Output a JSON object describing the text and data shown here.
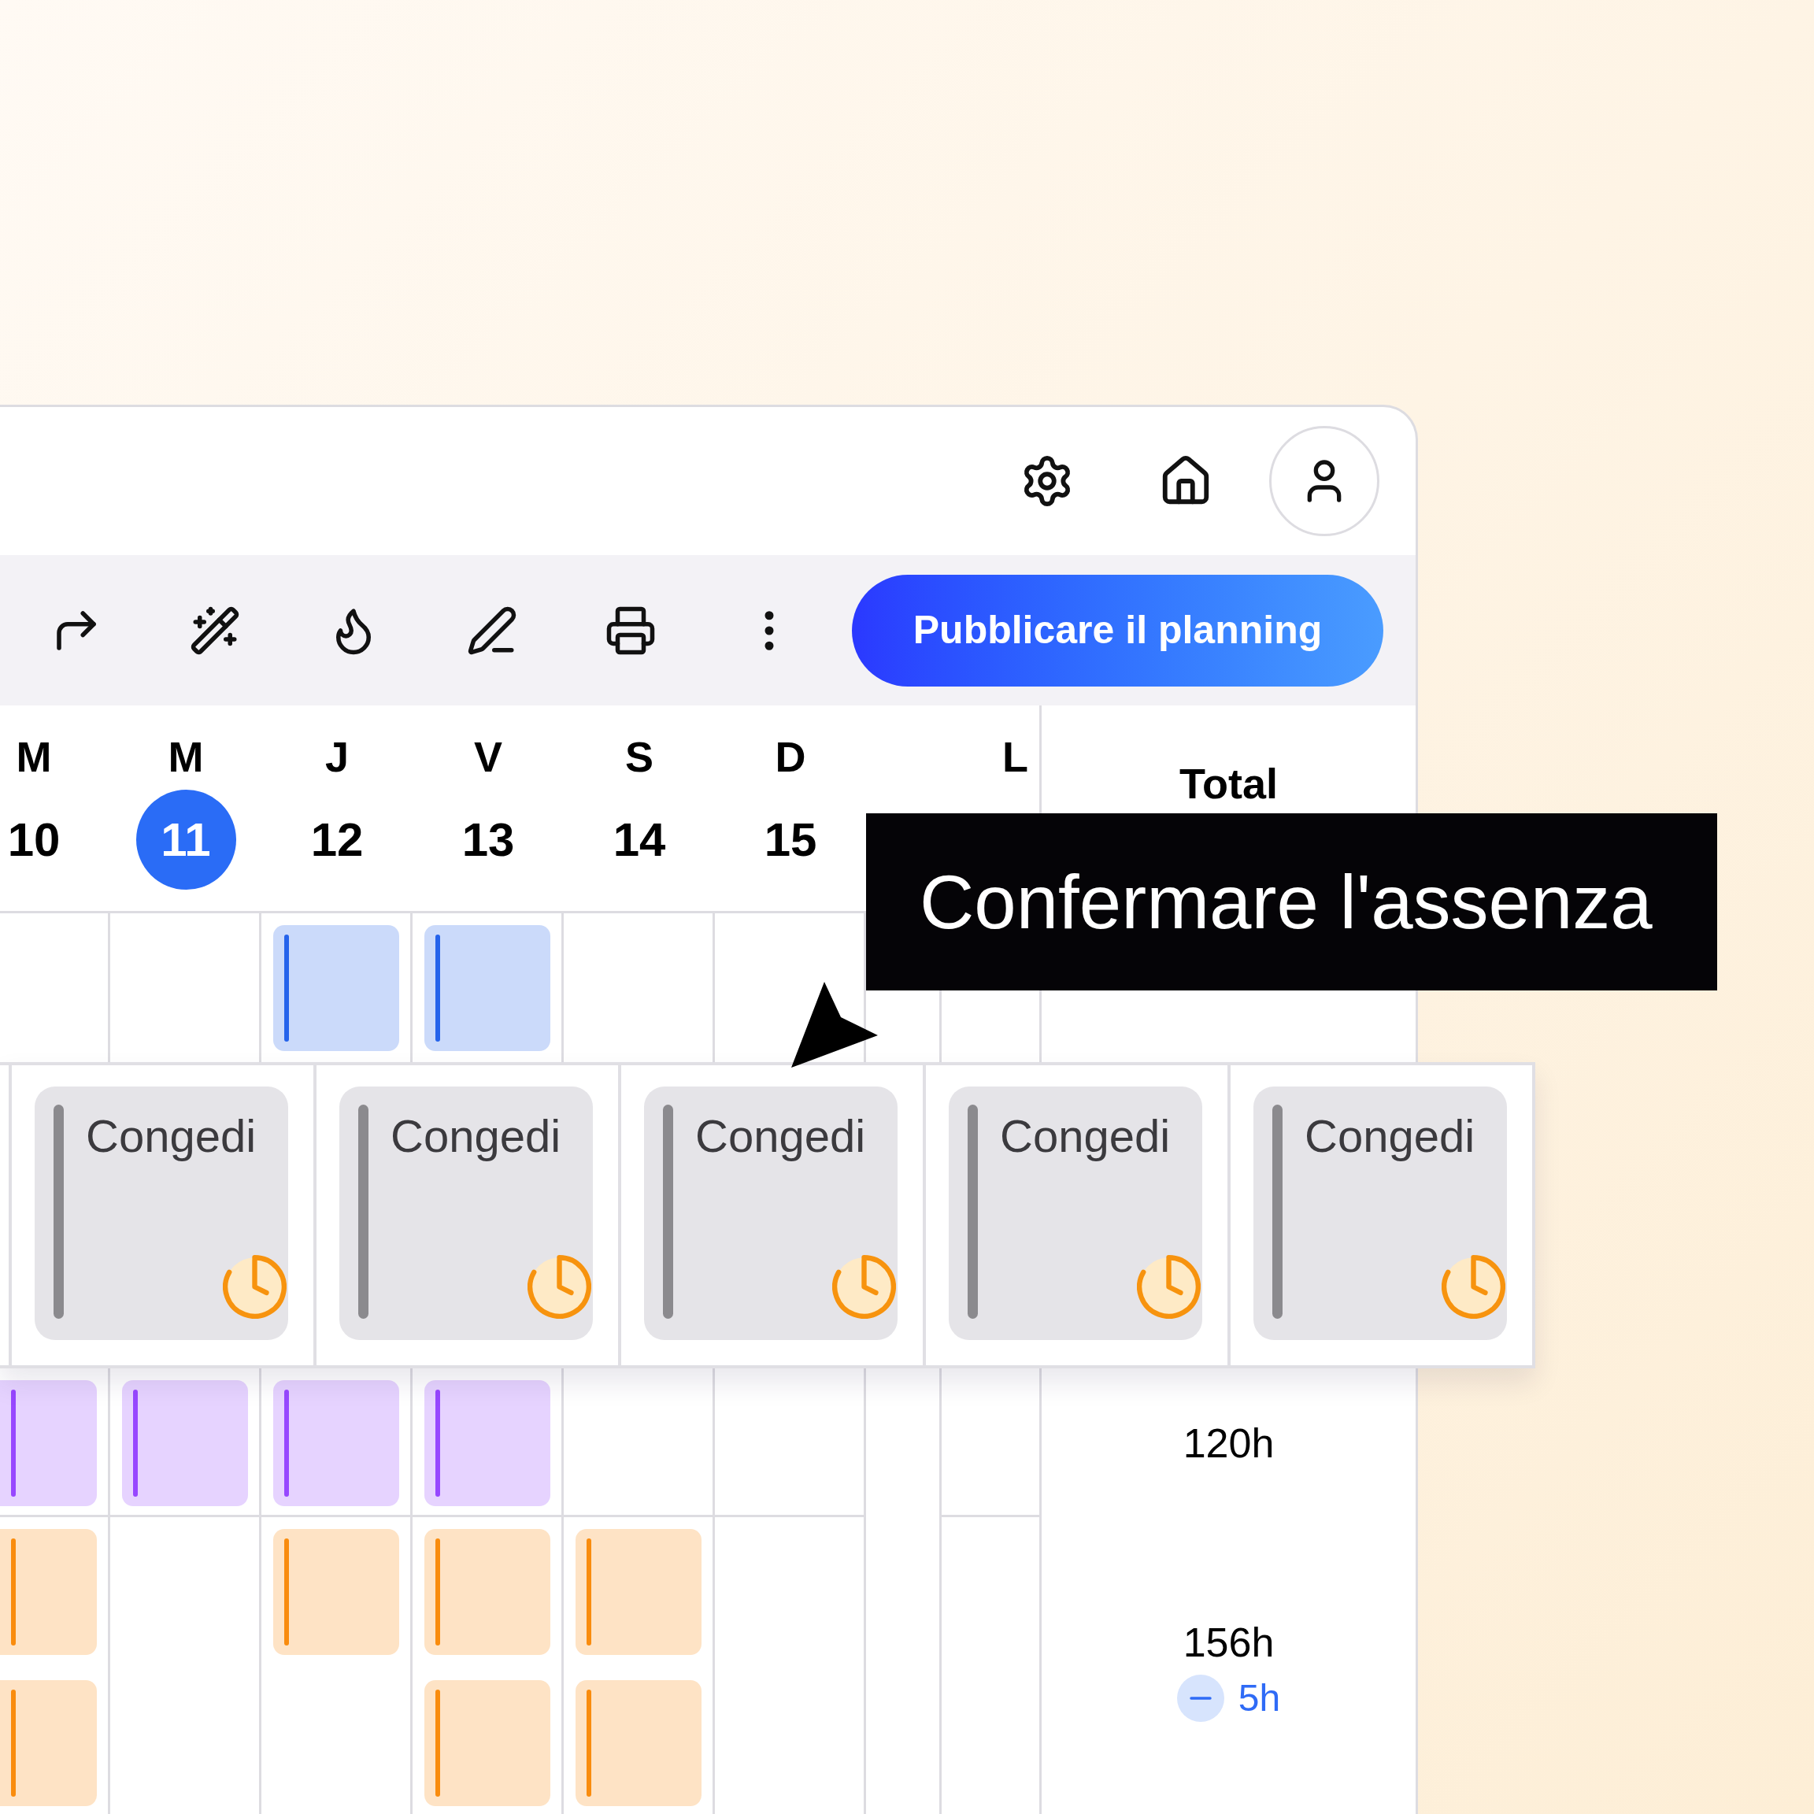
{
  "toolbar": {
    "publish_button": "Pubblicare il planning"
  },
  "days": [
    {
      "weekday": "M",
      "date": "10",
      "selected": false
    },
    {
      "weekday": "M",
      "date": "11",
      "selected": true
    },
    {
      "weekday": "J",
      "date": "12",
      "selected": false
    },
    {
      "weekday": "V",
      "date": "13",
      "selected": false
    },
    {
      "weekday": "S",
      "date": "14",
      "selected": false
    },
    {
      "weekday": "D",
      "date": "15",
      "selected": false
    },
    {
      "weekday": "L",
      "selected": false
    }
  ],
  "total_column": {
    "heading": "Total"
  },
  "rows": [
    {
      "kind": "shifts",
      "color": "#2563eb",
      "lanes": [
        [
          false,
          false,
          true,
          true,
          false,
          false,
          false,
          false
        ]
      ]
    },
    {
      "kind": "absence",
      "cells": [
        "Congedi",
        "Congedi",
        "Congedi",
        "Congedi",
        "Congedi"
      ]
    },
    {
      "kind": "shifts",
      "color": "#9747ff",
      "lanes": [
        [
          true,
          true,
          true,
          true,
          false,
          false,
          false,
          false
        ]
      ],
      "total": "120h"
    },
    {
      "kind": "shifts",
      "color": "#f98c0e",
      "lanes": [
        [
          true,
          false,
          true,
          true,
          true,
          false,
          false,
          false
        ],
        [
          true,
          false,
          false,
          true,
          true,
          false,
          false,
          false
        ]
      ],
      "total": "156h",
      "difference": "5h"
    }
  ],
  "tooltip": "Confermare l'assenza"
}
